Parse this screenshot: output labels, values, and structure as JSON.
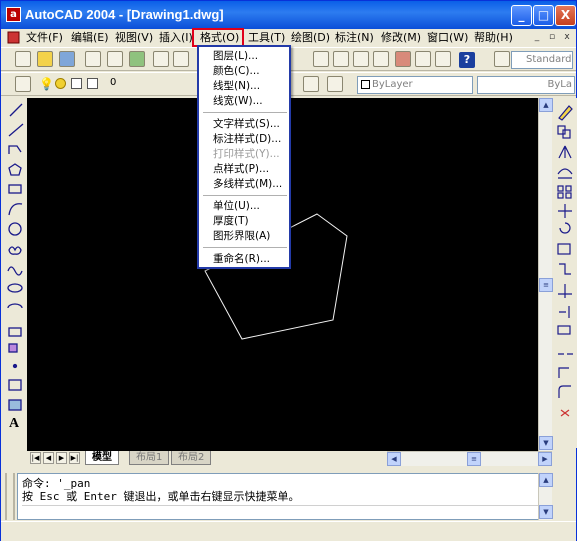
{
  "window": {
    "title": "AutoCAD 2004 - [Drawing1.dwg]",
    "app_icon_letter": "a",
    "min_label": "_",
    "max_label": "□",
    "close_label": "X"
  },
  "menubar": {
    "items": [
      "文件(F)",
      "编辑(E)",
      "视图(V)",
      "插入(I)",
      "格式(O)",
      "工具(T)",
      "绘图(D)",
      "标注(N)",
      "修改(M)",
      "窗口(W)",
      "帮助(H)"
    ],
    "mdi": [
      "_",
      "▫",
      "x"
    ]
  },
  "toolbar": {
    "help_label": "?",
    "text_style_combo": "Standard",
    "layer_value": "0",
    "color_combo": "ByLayer",
    "linetype_combo": "ByLa"
  },
  "format_menu": {
    "group1": [
      "图层(L)...",
      "颜色(C)...",
      "线型(N)...",
      "线宽(W)..."
    ],
    "group2": [
      "文字样式(S)...",
      "标注样式(D)...",
      "打印样式(Y)...",
      "点样式(P)...",
      "多线样式(M)..."
    ],
    "group3": [
      "单位(U)...",
      "厚度(T)",
      "图形界限(A)"
    ],
    "group4": [
      "重命名(R)..."
    ],
    "disabled_item": "打印样式(Y)..."
  },
  "left_toolbar_icons": [
    "line-icon",
    "construction-line-icon",
    "polyline-icon",
    "polygon-icon",
    "rectangle-icon",
    "arc-icon",
    "circle-icon",
    "revcloud-icon",
    "spline-icon",
    "ellipse-icon",
    "ellipse-arc-icon",
    "insert-block-icon",
    "make-block-icon",
    "point-icon",
    "hatch-icon",
    "region-icon",
    "mtext-icon"
  ],
  "left_toolbar_last_label": "A",
  "right_toolbar_icons": [
    "erase-icon",
    "copy-icon",
    "mirror-icon",
    "offset-icon",
    "array-icon",
    "move-icon",
    "rotate-icon",
    "scale-icon",
    "stretch-icon",
    "trim-icon",
    "extend-icon",
    "break-icon",
    "join-icon",
    "chamfer-icon",
    "fillet-icon",
    "explode-icon"
  ],
  "tabs": {
    "items": [
      "模型",
      "布局1",
      "布局2"
    ],
    "active": "模型"
  },
  "command": {
    "line1": "命令: '_pan",
    "line2": "按 Esc 或 Enter 键退出，或单击右键显示快捷菜单。"
  },
  "colors": {
    "canvas": "#000000",
    "polygon_stroke": "#ffffff",
    "highlight_box": "#e0001a",
    "menu_border": "#233aa8"
  }
}
